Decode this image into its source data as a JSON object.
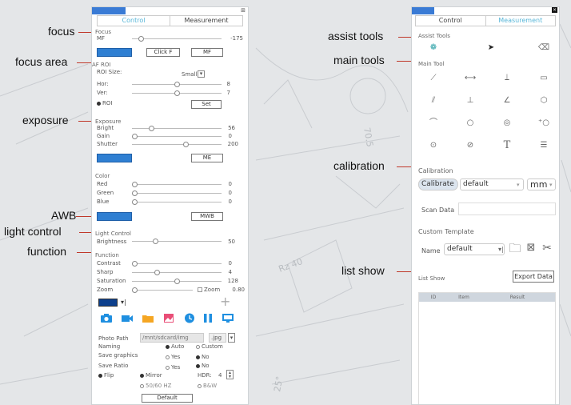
{
  "callouts": {
    "focus": "focus",
    "focus_area": "focus area",
    "exposure": "exposure",
    "awb": "AWB",
    "light_control": "light control",
    "function": "function",
    "assist_tools": "assist tools",
    "main_tools": "main tools",
    "calibration": "calibration",
    "list_show": "list show"
  },
  "left": {
    "tabs": [
      "Control",
      "Measurement"
    ],
    "focus": {
      "title": "Focus",
      "mf_label": "MF",
      "mf_value": "-175",
      "mf_level": 0.08,
      "click_f": "Click F",
      "mf_btn": "MF"
    },
    "af_roi": {
      "title": "AF ROI",
      "roi_size_label": "ROI Size:",
      "roi_size_value": "Small",
      "hor_label": "Hor:",
      "hor_value": "8",
      "ver_label": "Ver:",
      "ver_value": "7",
      "roi_label": "ROI",
      "set_btn": "Set"
    },
    "exposure": {
      "title": "Exposure",
      "bright_label": "Bright",
      "bright_value": "56",
      "gain_label": "Gain",
      "gain_value": "0",
      "shutter_label": "Shutter",
      "shutter_value": "200",
      "me_btn": "ME"
    },
    "color": {
      "title": "Color",
      "red_label": "Red",
      "red_value": "0",
      "green_label": "Green",
      "green_value": "0",
      "blue_label": "Blue",
      "blue_value": "0",
      "mwb_btn": "MWB"
    },
    "light": {
      "title": "Light Control",
      "brightness_label": "Brightness",
      "brightness_value": "50"
    },
    "function": {
      "title": "Function",
      "contrast_label": "Contrast",
      "contrast_value": "0",
      "sharp_label": "Sharp",
      "sharp_value": "4",
      "saturation_label": "Saturation",
      "saturation_value": "128",
      "zoom_label": "Zoom",
      "zoom_check": "Zoom",
      "zoom_value": "0.80"
    },
    "photo": {
      "path_label": "Photo Path",
      "path_value": "/mnt/sdcard/img",
      "ext_value": ".jpg",
      "naming_label": "Naming",
      "auto": "Auto",
      "custom": "Custom",
      "save_graphics": "Save graphics",
      "save_ratio": "Save Ratio",
      "yes": "Yes",
      "no": "No",
      "flip": "Flip",
      "mirror": "Mirror",
      "hdr_label": "HDR:",
      "hdr_value": "4",
      "hz": "50/60 HZ",
      "bw": "B&W",
      "default_btn": "Default"
    }
  },
  "right": {
    "tabs": [
      "Control",
      "Measurement"
    ],
    "assist_title": "Assist Tools",
    "main_title": "Main Tool",
    "calibration": {
      "title": "Calibration",
      "calibrate_btn": "Calibrate",
      "default_value": "default",
      "unit": "mm",
      "scan_data": "Scan Data"
    },
    "template": {
      "title": "Custom Template",
      "name_label": "Name",
      "name_value": "default"
    },
    "list": {
      "title": "List Show",
      "export_btn": "Export Data",
      "columns": [
        "ID",
        "Item",
        "Result"
      ]
    }
  },
  "colors": {
    "blue_button": "#2f7fd2",
    "callout_line": "#c0392b",
    "tab_active": "#58b6d8",
    "accent": "#1f8fe0"
  }
}
